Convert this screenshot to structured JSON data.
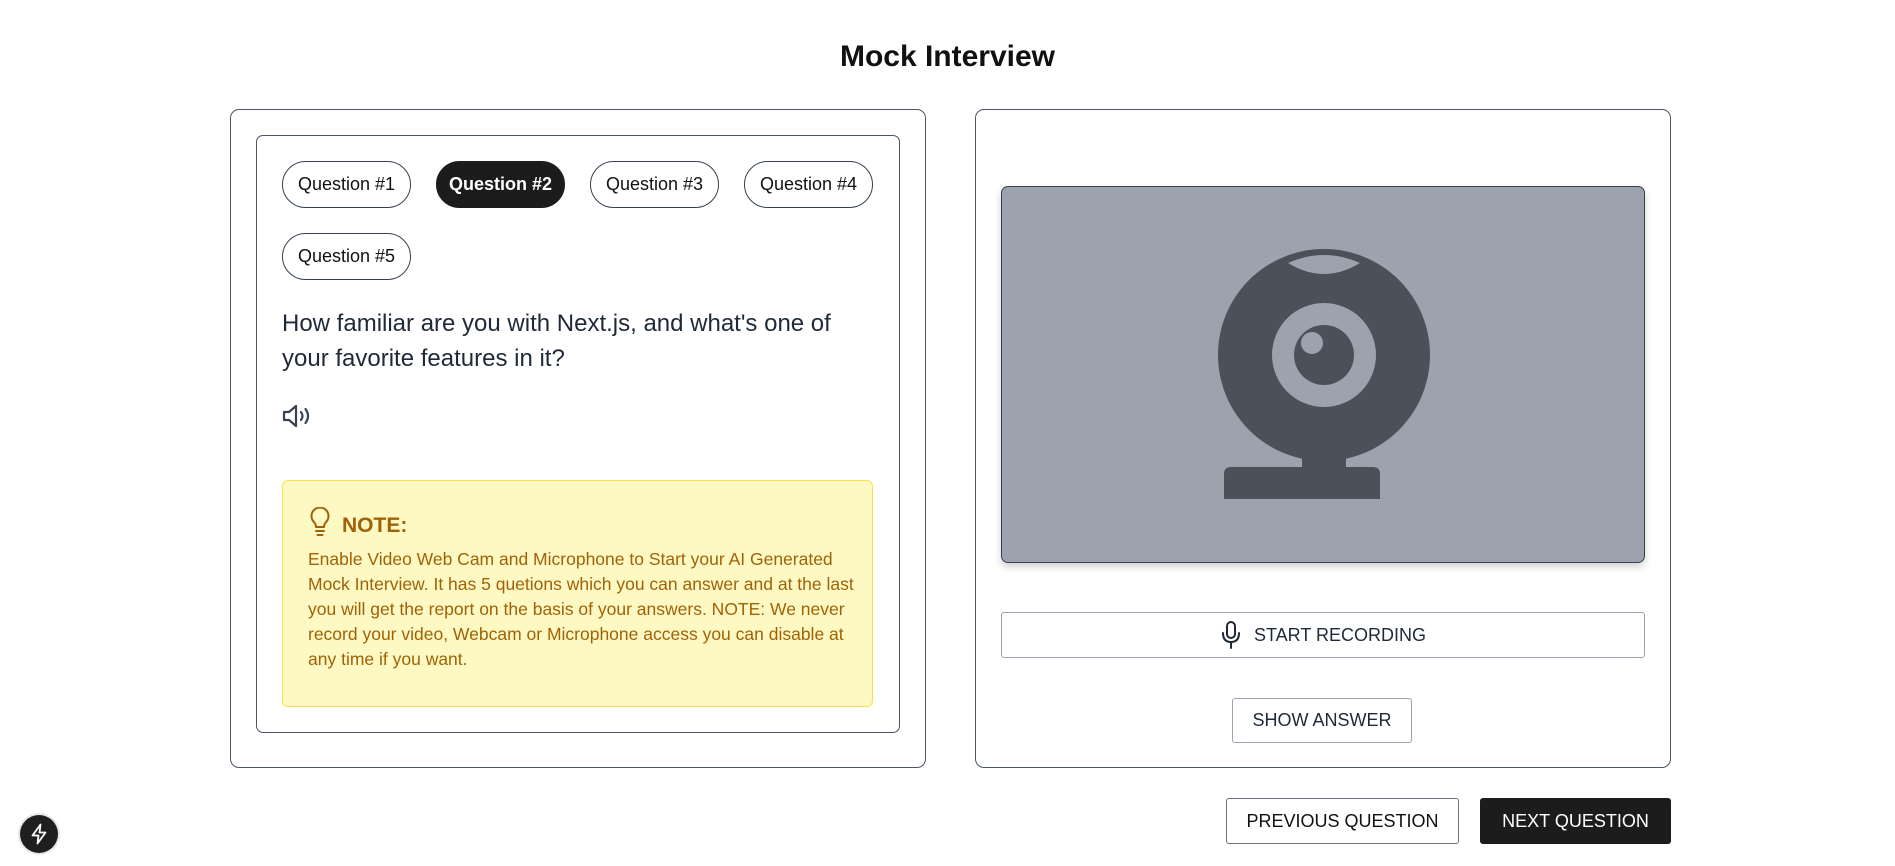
{
  "page": {
    "title": "Mock Interview"
  },
  "questions": {
    "tabs": [
      {
        "label": "Question #1"
      },
      {
        "label": "Question #2"
      },
      {
        "label": "Question #3"
      },
      {
        "label": "Question #4"
      },
      {
        "label": "Question #5"
      }
    ],
    "active_index": 1,
    "current_text": "How familiar are you with Next.js, and what's one of your favorite features in it?"
  },
  "note": {
    "title": "NOTE:",
    "body": "Enable Video Web Cam and Microphone to Start your AI Generated Mock Interview. It has 5 quetions which you can answer and at the last you will get the report on the basis of your answers. NOTE: We never record your video, Webcam or Microphone access you can disable at any time if you want."
  },
  "recorder": {
    "start_label": "START RECORDING",
    "show_answer_label": "SHOW ANSWER"
  },
  "navigation": {
    "previous_label": "PREVIOUS QUESTION",
    "next_label": "NEXT QUESTION"
  },
  "icons": {
    "speaker": "speaker-icon",
    "lightbulb": "lightbulb-icon",
    "webcam": "webcam-icon",
    "microphone": "microphone-icon",
    "dev_badge": "lightning-icon"
  },
  "colors": {
    "active_tab": "#1c1c1c",
    "note_bg": "#fef9c3",
    "note_text": "#a16207",
    "webcam_bg": "#9ca3af",
    "webcam_icon": "#4b5059"
  }
}
